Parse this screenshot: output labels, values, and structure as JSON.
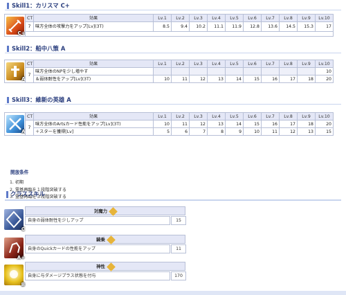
{
  "headers": {
    "ct": "CT",
    "effect": "効果",
    "levels": [
      "Lv.1",
      "Lv.2",
      "Lv.3",
      "Lv.4",
      "Lv.5",
      "Lv.6",
      "Lv.7",
      "Lv.8",
      "Lv.9",
      "Lv.10"
    ]
  },
  "skills": [
    {
      "title": "Skill1：カリスマ C+",
      "rank": "C+",
      "icon_color": "#d94a17",
      "ct": "7",
      "rows": [
        {
          "effect": "味方全体の攻撃力をアップ[Lv](3T)",
          "values": [
            "8.5",
            "9.4",
            "10.2",
            "11.1",
            "11.9",
            "12.8",
            "13.6",
            "14.5",
            "15.3",
            "17"
          ]
        }
      ]
    },
    {
      "title": "Skill2：船中八策 A",
      "rank": "A",
      "icon_color": "#c98a1e",
      "ct": "7",
      "rows": [
        {
          "effect": "味方全体のNPを少し増やす",
          "values": [
            "",
            "",
            "",
            "",
            "",
            "",
            "",
            "",
            "",
            "10"
          ]
        },
        {
          "effect": "＆弱体耐性をアップ[Lv](3T)",
          "values": [
            "10",
            "11",
            "12",
            "13",
            "14",
            "15",
            "16",
            "17",
            "18",
            "20"
          ]
        }
      ]
    },
    {
      "title": "Skill3：維新の英雄 A",
      "rank": "A",
      "icon_color": "#3d8fd8",
      "ct": "7",
      "rows": [
        {
          "effect": "味方全体のArtsカード性能をアップ[Lv](3T)",
          "values": [
            "10",
            "11",
            "12",
            "13",
            "14",
            "15",
            "16",
            "17",
            "18",
            "20"
          ]
        },
        {
          "effect": "＋スターを獲得[Lv]",
          "values": [
            "5",
            "6",
            "7",
            "8",
            "9",
            "10",
            "11",
            "12",
            "13",
            "15"
          ]
        }
      ]
    }
  ],
  "conditions": {
    "title": "開放条件",
    "items": [
      "1. 初期",
      "2. 霊基再臨を１段階突破する",
      "3. 霊基再臨を３段階突破する"
    ]
  },
  "class_skills_title": "クラススキル",
  "class_skills": [
    {
      "name": "対魔力",
      "rank": "C",
      "icon_color": "#3b5a9a",
      "desc": "自身の弱体耐性を少しアップ",
      "value": "15"
    },
    {
      "name": "騎乗",
      "rank": "A+",
      "icon_color": "#8a2418",
      "desc": "自身のQuickカードの性能をアップ",
      "value": "11"
    },
    {
      "name": "神性",
      "rank": "B",
      "icon_color": "#e8c21e",
      "desc": "自身に与ダメージプラス状態を付与",
      "value": "170"
    }
  ]
}
